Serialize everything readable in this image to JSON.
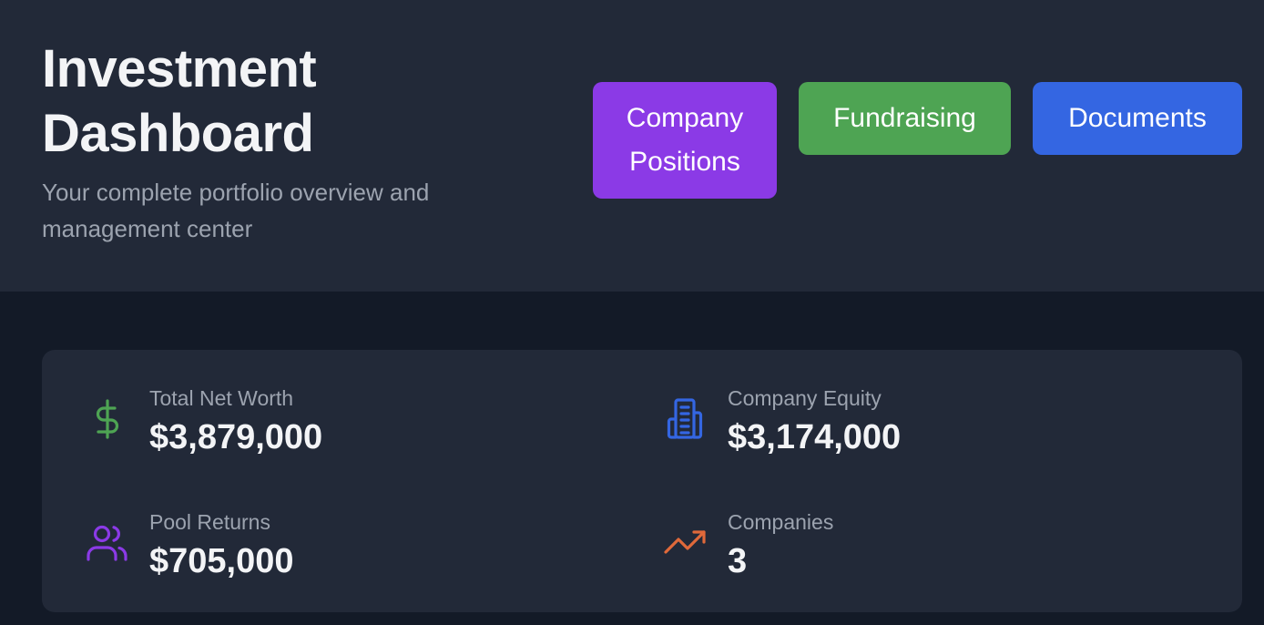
{
  "header": {
    "title": "Investment Dashboard",
    "subtitle": "Your complete portfolio overview and management center"
  },
  "nav": {
    "company_positions_label": "Company Positions",
    "fundraising_label": "Fundraising",
    "documents_label": "Documents"
  },
  "colors": {
    "header_bg": "#222938",
    "page_bg": "#131a27",
    "purple": "#8b3ae6",
    "green": "#4ea453",
    "blue": "#3466e2",
    "orange": "#e0693a"
  },
  "stats": [
    {
      "label": "Total Net Worth",
      "value": "$3,879,000",
      "icon": "dollar-icon"
    },
    {
      "label": "Company Equity",
      "value": "$3,174,000",
      "icon": "building-icon"
    },
    {
      "label": "Pool Returns",
      "value": "$705,000",
      "icon": "users-icon"
    },
    {
      "label": "Companies",
      "value": "3",
      "icon": "trending-up-icon"
    }
  ]
}
